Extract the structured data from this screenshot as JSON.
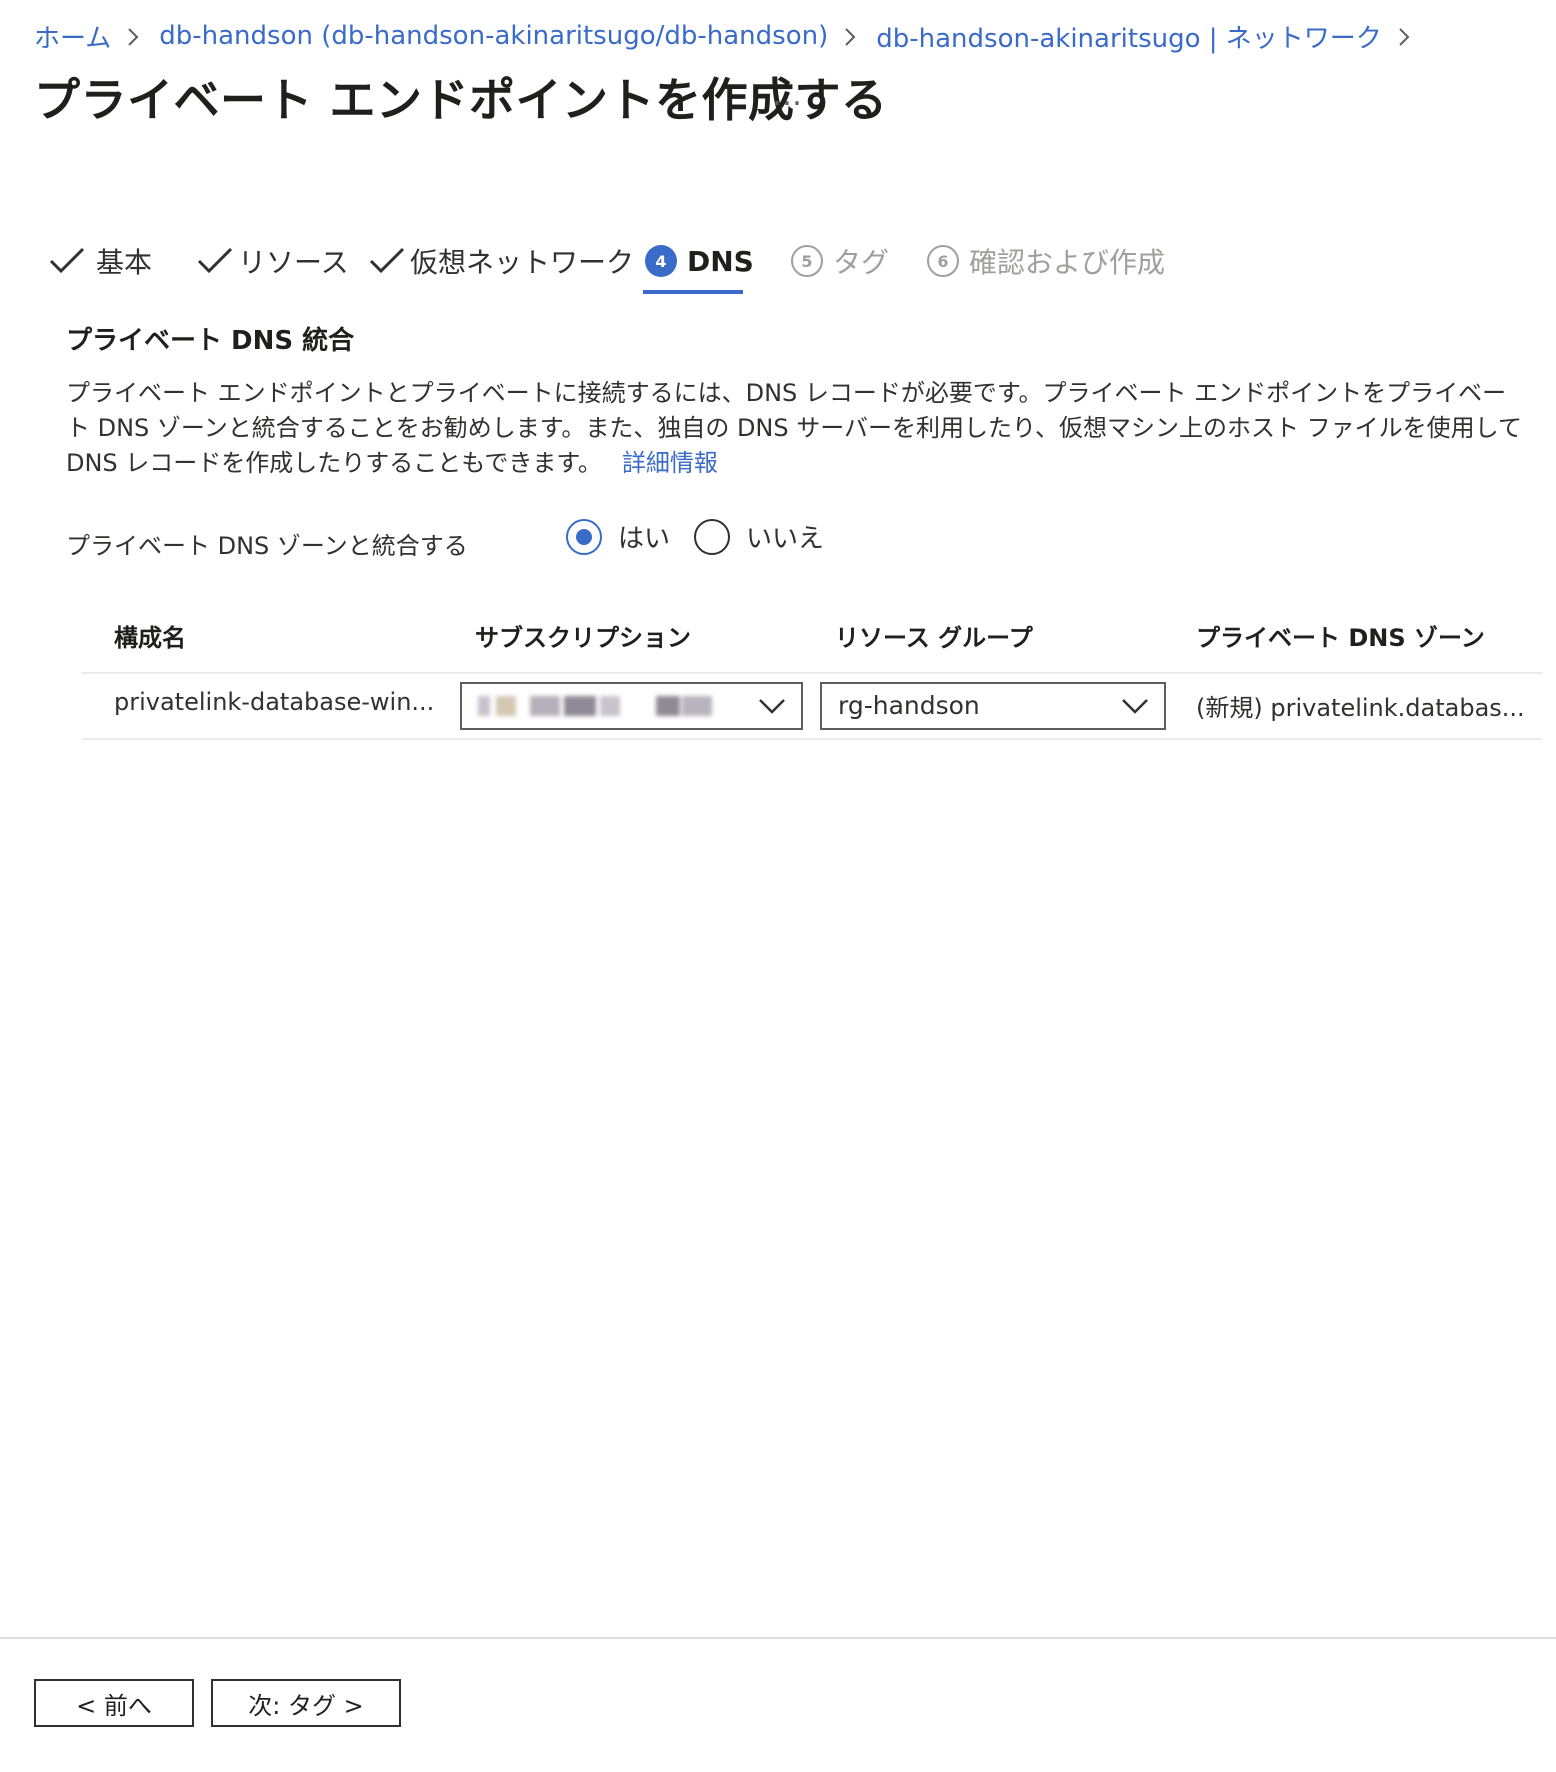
{
  "breadcrumb": {
    "items": [
      "ホーム",
      "db-handson (db-handson-akinaritsugo/db-handson)",
      "db-handson-akinaritsugo | ネットワーク"
    ]
  },
  "page": {
    "title": "プライベート エンドポイントを作成する",
    "more": "…"
  },
  "tabs": [
    {
      "label": "基本",
      "state": "done"
    },
    {
      "label": "リソース",
      "state": "done"
    },
    {
      "label": "仮想ネットワーク",
      "state": "done"
    },
    {
      "number": "4",
      "label": "DNS",
      "state": "active"
    },
    {
      "number": "5",
      "label": "タグ",
      "state": "disabled"
    },
    {
      "number": "6",
      "label": "確認および作成",
      "state": "disabled"
    }
  ],
  "section": {
    "title": "プライベート DNS 統合",
    "description": "プライベート エンドポイントとプライベートに接続するには、DNS レコードが必要です。プライベート エンドポイントをプライベート DNS ゾーンと統合することをお勧めします。また、独自の DNS サーバーを利用したり、仮想マシン上のホスト ファイルを使用して DNS レコードを作成したりすることもできます。",
    "learn_more": "詳細情報"
  },
  "integrate": {
    "label": "プライベート DNS ゾーンと統合する",
    "options": [
      "はい",
      "いいえ"
    ],
    "selected": "はい"
  },
  "table": {
    "headers": [
      "構成名",
      "サブスクリプション",
      "リソース グループ",
      "プライベート DNS ゾーン"
    ],
    "rows": [
      {
        "config_name": "privatelink-database-win...",
        "resource_group": "rg-handson",
        "dns_zone": "(新規) privatelink.databas..."
      }
    ]
  },
  "footer": {
    "prev_label": "< 前へ",
    "next_label": "次: タグ >"
  },
  "colors": {
    "accent": "#3a6bc9",
    "text": "#323130",
    "disabled": "#a19f9d"
  }
}
